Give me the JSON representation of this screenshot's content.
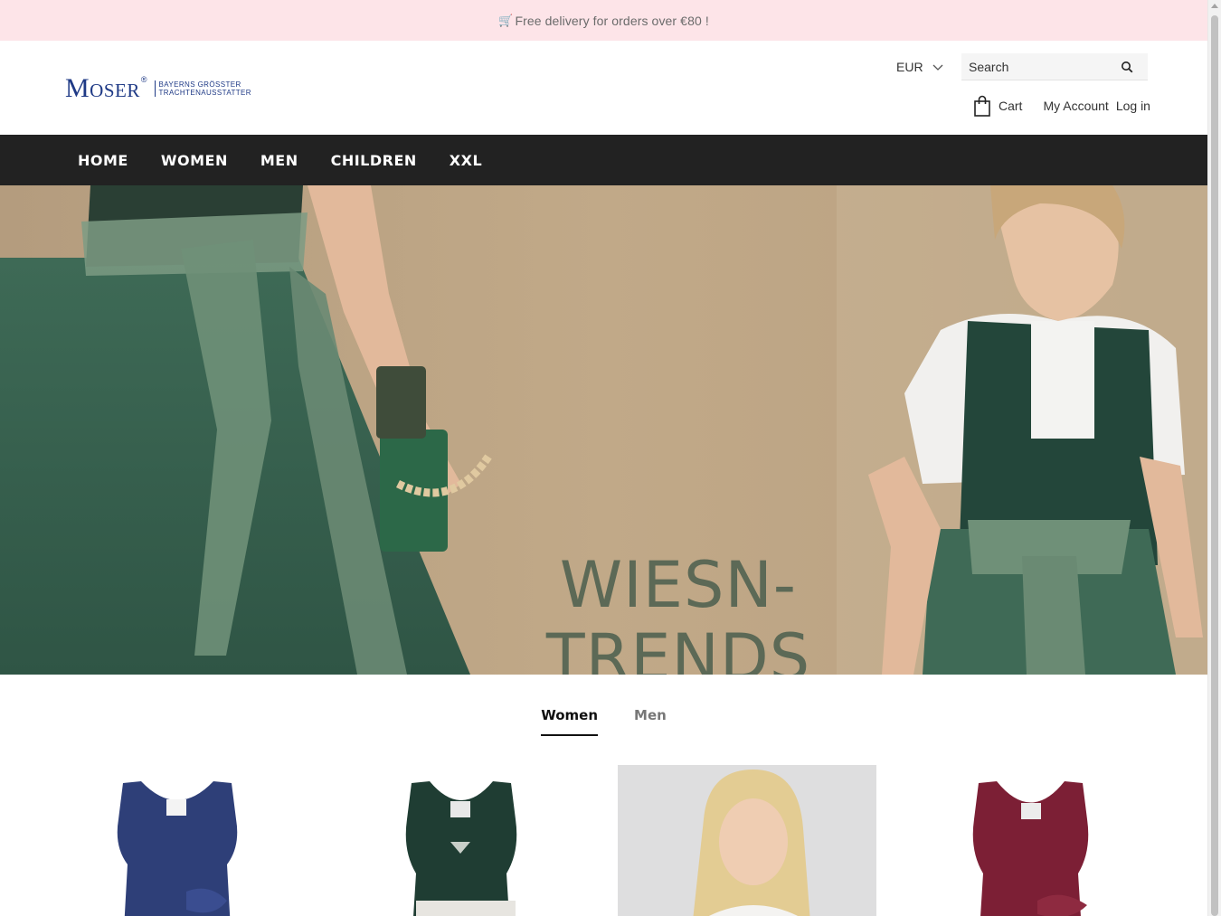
{
  "announcement": {
    "icon": "🛒",
    "text": "Free delivery for orders over €80 !"
  },
  "header": {
    "logo_word": "Moser",
    "logo_reg": "®",
    "logo_tagline_1": "BAYERNS GRÖSSTER",
    "logo_tagline_2": "TRACHTENAUSSTATTER",
    "currency": "EUR",
    "search_placeholder": "Search",
    "cart_label": "Cart",
    "account_label": "My Account",
    "login_label": "Log in"
  },
  "nav": {
    "items": [
      {
        "label": "HOME"
      },
      {
        "label": "WOMEN"
      },
      {
        "label": "MEN"
      },
      {
        "label": "CHILDREN"
      },
      {
        "label": "XXL"
      }
    ]
  },
  "hero": {
    "line1": "WIESN-",
    "line2": "TRENDS"
  },
  "tabs": {
    "items": [
      {
        "label": "Women",
        "active": true
      },
      {
        "label": "Men",
        "active": false
      }
    ]
  },
  "colors": {
    "announce_bg": "#fde4e8",
    "nav_bg": "#222222",
    "brand_blue": "#1f3a86",
    "hero_text": "#4f6150"
  }
}
